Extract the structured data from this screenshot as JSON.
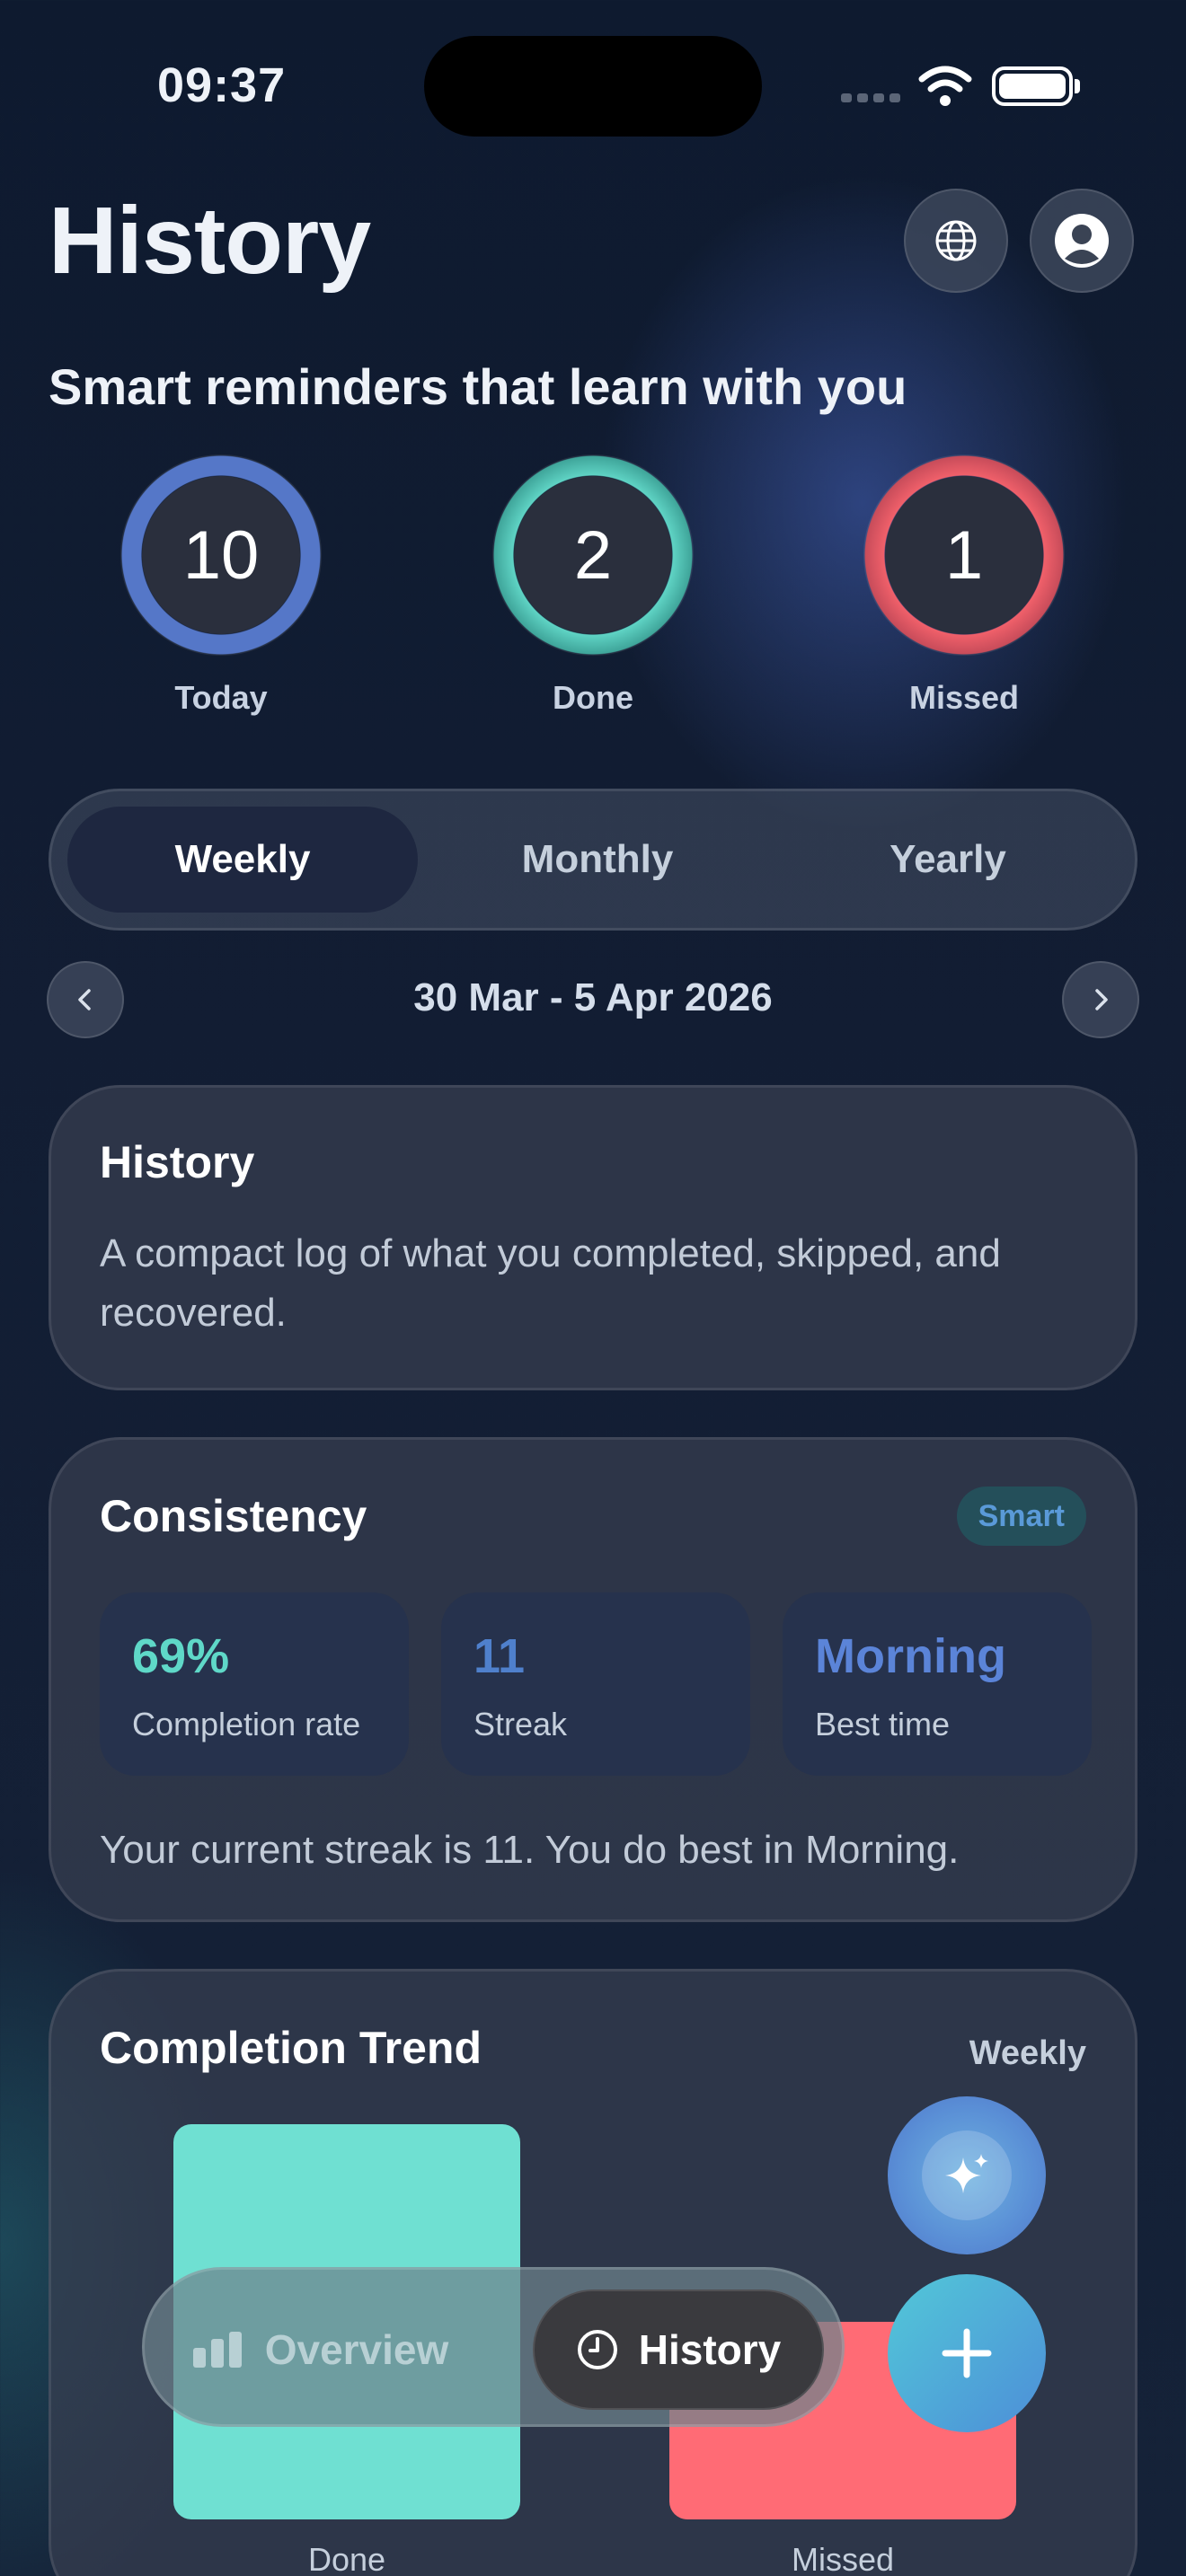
{
  "status_bar": {
    "time": "09:37"
  },
  "header": {
    "title": "History",
    "globe_icon": "globe-icon",
    "profile_icon": "person-circle-icon"
  },
  "subtitle": "Smart reminders that learn with you",
  "summary": [
    {
      "value": "10",
      "label": "Today",
      "color": "#5577c8"
    },
    {
      "value": "2",
      "label": "Done",
      "color": "#5fd3c4"
    },
    {
      "value": "1",
      "label": "Missed",
      "color": "#f0606a"
    }
  ],
  "period_tabs": {
    "items": [
      "Weekly",
      "Monthly",
      "Yearly"
    ],
    "selected": "Weekly"
  },
  "date_range": "30 Mar - 5 Apr 2026",
  "history_card": {
    "title": "History",
    "body": "A compact log of what you completed, skipped, and recovered."
  },
  "consistency_card": {
    "title": "Consistency",
    "badge": "Smart",
    "metrics": [
      {
        "value": "69%",
        "label": "Completion rate",
        "color": "#5fd8c8"
      },
      {
        "value": "11",
        "label": "Streak",
        "color": "#4f80cc"
      },
      {
        "value": "Morning",
        "label": "Best time",
        "color": "#5b84d8"
      }
    ],
    "summary": "Your current streak is 11. You do best in Morning."
  },
  "trend_card": {
    "title": "Completion Trend",
    "period": "Weekly"
  },
  "chart_data": {
    "type": "bar",
    "categories": [
      "Done",
      "Missed"
    ],
    "values": [
      2,
      1
    ],
    "colors": [
      "#6fe0d2",
      "#ff6b75"
    ]
  },
  "tab_bar": {
    "overview_label": "Overview",
    "history_label": "History",
    "selected": "History"
  },
  "fab": {
    "assistant_icon": "sparkles-icon",
    "add_icon": "plus-icon"
  }
}
